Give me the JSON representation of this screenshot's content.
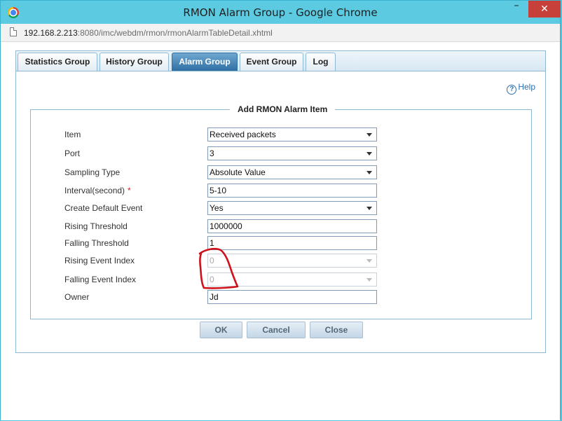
{
  "window": {
    "title": "RMON Alarm Group - Google Chrome",
    "minimize": "–",
    "close": "✕"
  },
  "address": {
    "host": "192.168.2.213",
    "rest": ":8080/imc/webdm/rmon/rmonAlarmTableDetail.xhtml"
  },
  "tabs": [
    "Statistics Group",
    "History Group",
    "Alarm Group",
    "Event Group",
    "Log"
  ],
  "active_tab": "Alarm Group",
  "help": {
    "icon": "?",
    "label": "Help"
  },
  "form": {
    "legend": "Add RMON Alarm Item",
    "required_marker": "*",
    "fields": {
      "item": {
        "label": "Item",
        "value": "Received packets"
      },
      "port": {
        "label": "Port",
        "value": "3"
      },
      "sampling_type": {
        "label": "Sampling Type",
        "value": "Absolute Value"
      },
      "interval": {
        "label": "Interval(second)",
        "value": "5-10"
      },
      "create_default_event": {
        "label": "Create Default Event",
        "value": "Yes"
      },
      "rising_threshold": {
        "label": "Rising Threshold",
        "value": "1000000"
      },
      "falling_threshold": {
        "label": "Falling Threshold",
        "value": "1"
      },
      "rising_event_index": {
        "label": "Rising Event Index",
        "value": "0"
      },
      "falling_event_index": {
        "label": "Falling Event Index",
        "value": "0"
      },
      "owner": {
        "label": "Owner",
        "value": "Jd"
      }
    }
  },
  "buttons": {
    "ok": "OK",
    "cancel": "Cancel",
    "close": "Close"
  },
  "colors": {
    "accent": "#2f6fa4",
    "annotation": "#d0101a",
    "required": "#d02020"
  }
}
